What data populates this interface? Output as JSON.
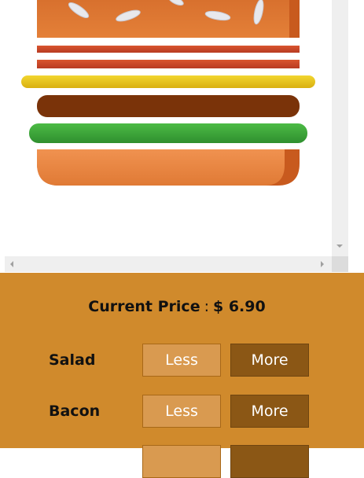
{
  "price": {
    "label": "Current Price",
    "separator": ":",
    "value": "$ 6.90"
  },
  "ingredients": [
    {
      "name": "Salad",
      "less_label": "Less",
      "more_label": "More"
    },
    {
      "name": "Bacon",
      "less_label": "Less",
      "more_label": "More"
    },
    {
      "name": "",
      "less_label": "",
      "more_label": ""
    }
  ],
  "colors": {
    "panel_bg": "#d08a2c",
    "less_button": "#d99a50",
    "more_button": "#8b5715",
    "bun": "#e07a35",
    "bacon": "#c8462a",
    "cheese": "#e9c21a",
    "patty": "#7a3309",
    "lettuce": "#3aa23a"
  }
}
